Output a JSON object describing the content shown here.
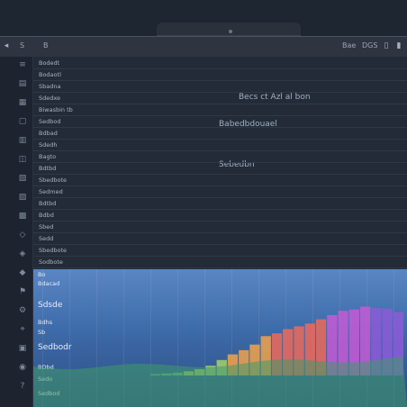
{
  "titlebar": {
    "left_label": "S",
    "left_label2": "B",
    "right_labels": [
      "Bae",
      "DGS"
    ]
  },
  "sidebar": {
    "icons": [
      "list-icon",
      "doc-icon",
      "grid-icon",
      "page-icon",
      "chart-icon",
      "layers-icon",
      "table-icon",
      "filter-icon",
      "note-icon",
      "shape-icon",
      "tag-icon",
      "stack-icon",
      "flag-icon",
      "gear-icon",
      "pin-icon",
      "lock-icon",
      "user-icon",
      "help-icon"
    ]
  },
  "rows": {
    "labels": [
      "Bodedt",
      "Bodaotl",
      "Sbadna",
      "Sdedxe",
      "Biwasbin tb",
      "Sedbod",
      "Bdbad",
      "Sdedh",
      "Bagto",
      "Bdtbd",
      "Sbedbote",
      "Sedmed",
      "Bdtbd",
      "Bdbd",
      "Sbed",
      "Sedd",
      "Sbedbote",
      "Sodbote"
    ]
  },
  "overlays": {
    "top": "Becs ct Azl al bon",
    "middle": "Babedbdouael",
    "lower": "Sebedbn"
  },
  "chart": {
    "labels": [
      "Bo",
      "Bdacad",
      "Sdsde",
      "Bdhs",
      "Sb",
      "Sedbodr",
      "BDbd",
      "Sedo",
      "Sedbod"
    ],
    "colors": [
      "#5fbf7a",
      "#a6d06a",
      "#f2a24a",
      "#ef6a5a",
      "#c75ad6",
      "#8e5bd8"
    ]
  },
  "chart_data": {
    "type": "bar",
    "values": [
      2,
      3,
      4,
      6,
      9,
      14,
      22,
      30,
      36,
      44,
      56,
      60,
      66,
      70,
      74,
      80,
      86,
      92,
      94,
      98,
      96,
      95,
      90
    ]
  }
}
